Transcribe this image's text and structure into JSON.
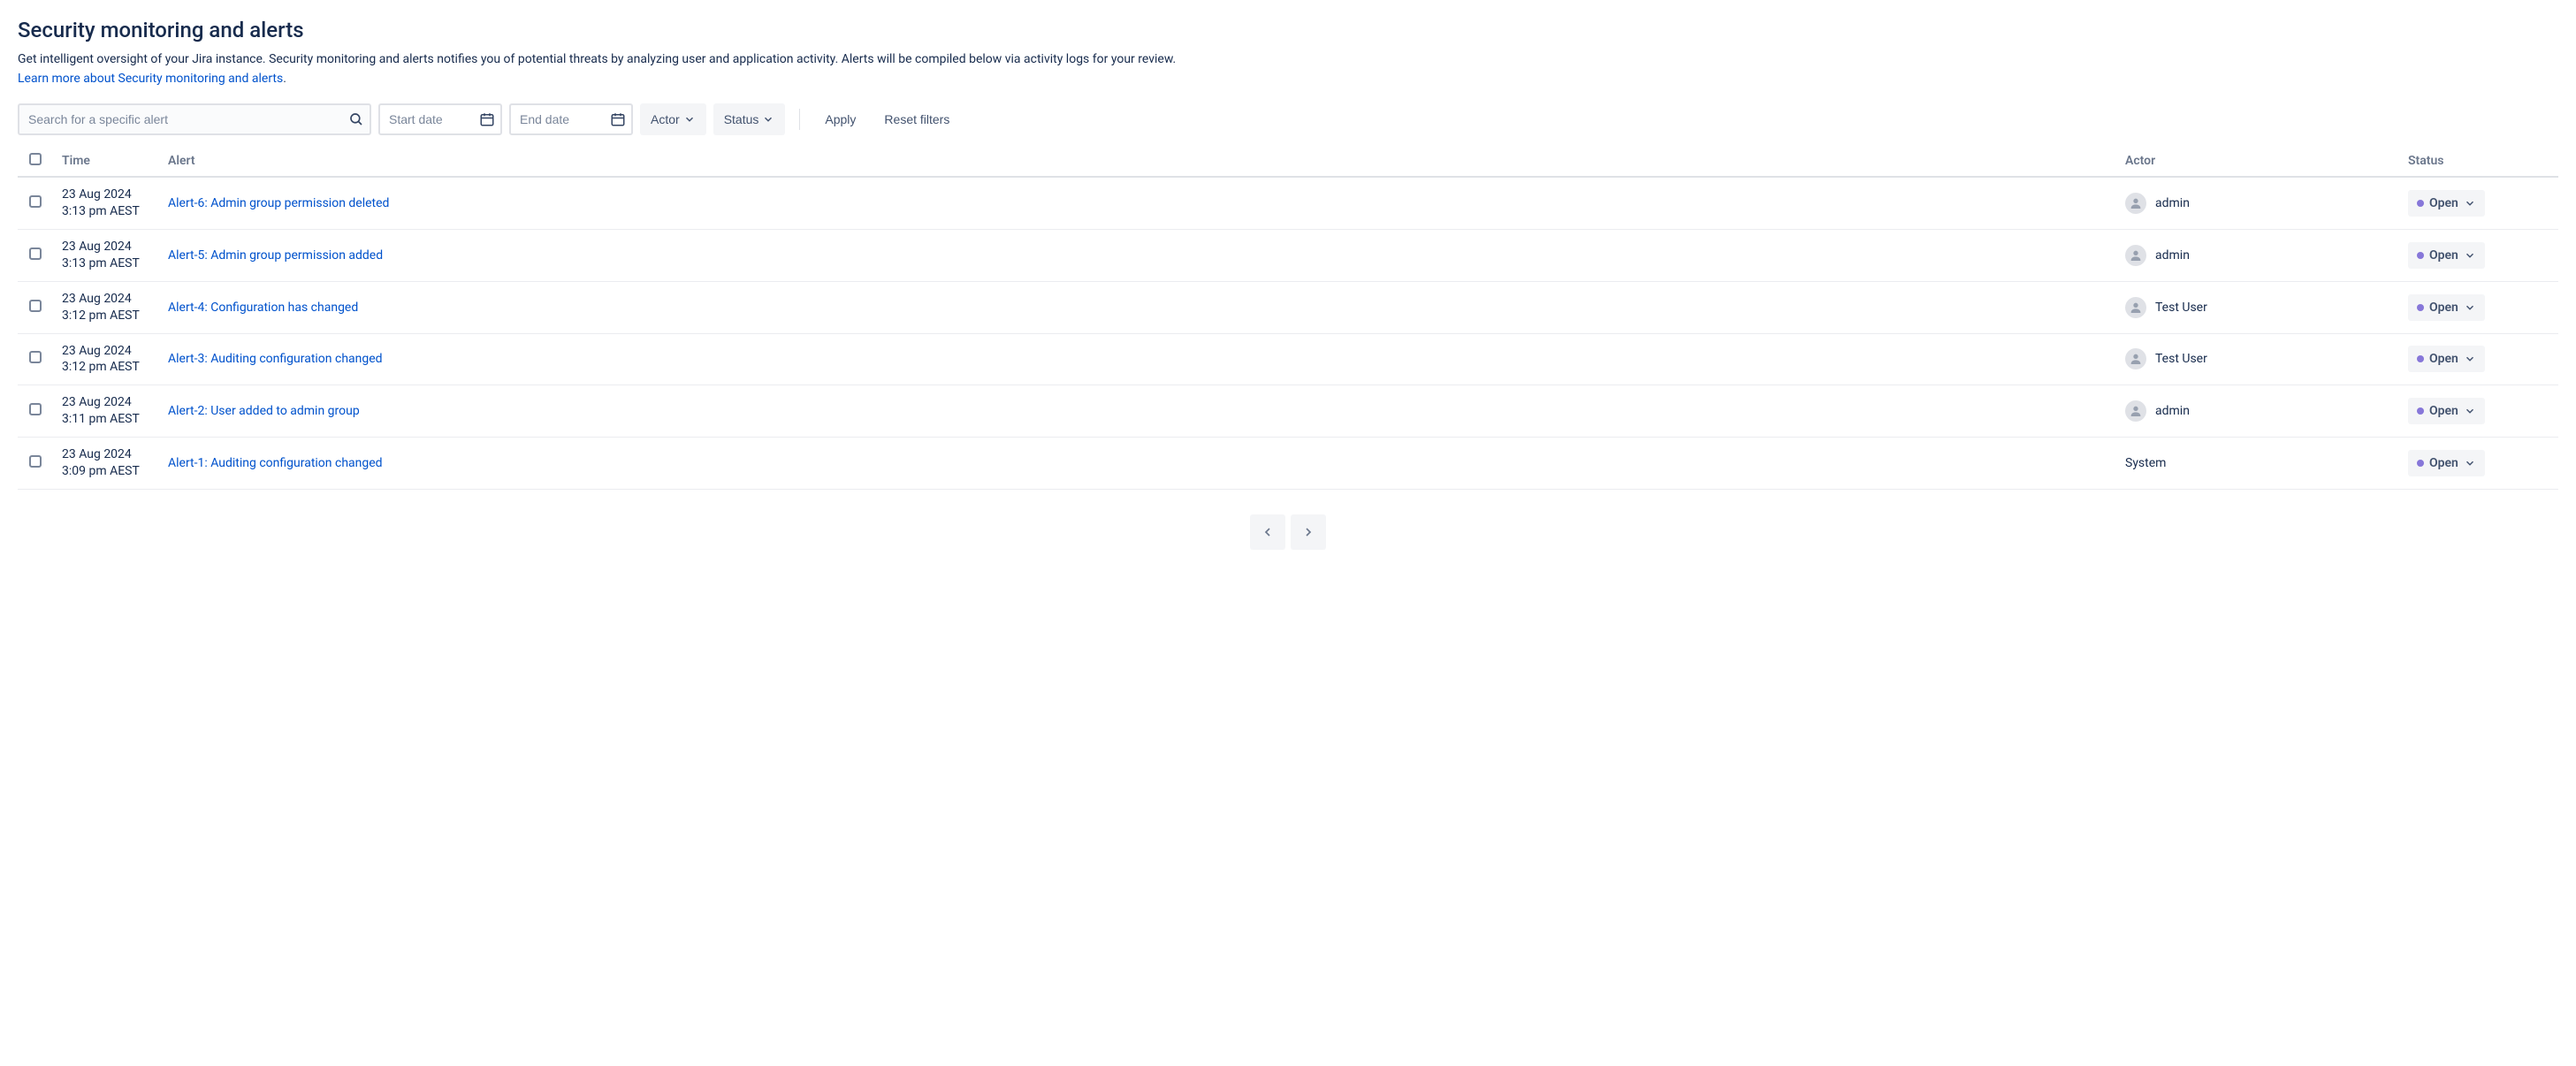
{
  "header": {
    "title": "Security monitoring and alerts",
    "description": "Get intelligent oversight of your Jira instance. Security monitoring and alerts notifies you of potential threats by analyzing user and application activity. Alerts will be compiled below via activity logs for your review.",
    "learn_more": "Learn more about Security monitoring and alerts",
    "learn_more_suffix": "."
  },
  "filters": {
    "search_placeholder": "Search for a specific alert",
    "start_date_placeholder": "Start date",
    "end_date_placeholder": "End date",
    "actor_label": "Actor",
    "status_label": "Status",
    "apply_label": "Apply",
    "reset_label": "Reset filters"
  },
  "table": {
    "headers": {
      "time": "Time",
      "alert": "Alert",
      "actor": "Actor",
      "status": "Status"
    },
    "rows": [
      {
        "date": "23 Aug 2024",
        "time": "3:13 pm AEST",
        "alert": "Alert-6: Admin group permission deleted",
        "actor": "admin",
        "avatar": true,
        "status": "Open"
      },
      {
        "date": "23 Aug 2024",
        "time": "3:13 pm AEST",
        "alert": "Alert-5: Admin group permission added",
        "actor": "admin",
        "avatar": true,
        "status": "Open"
      },
      {
        "date": "23 Aug 2024",
        "time": "3:12 pm AEST",
        "alert": "Alert-4: Configuration has changed",
        "actor": "Test User",
        "avatar": true,
        "status": "Open"
      },
      {
        "date": "23 Aug 2024",
        "time": "3:12 pm AEST",
        "alert": "Alert-3: Auditing configuration changed",
        "actor": "Test User",
        "avatar": true,
        "status": "Open"
      },
      {
        "date": "23 Aug 2024",
        "time": "3:11 pm AEST",
        "alert": "Alert-2: User added to admin group",
        "actor": "admin",
        "avatar": true,
        "status": "Open"
      },
      {
        "date": "23 Aug 2024",
        "time": "3:09 pm AEST",
        "alert": "Alert-1: Auditing configuration changed",
        "actor": "System",
        "avatar": false,
        "status": "Open"
      }
    ]
  }
}
